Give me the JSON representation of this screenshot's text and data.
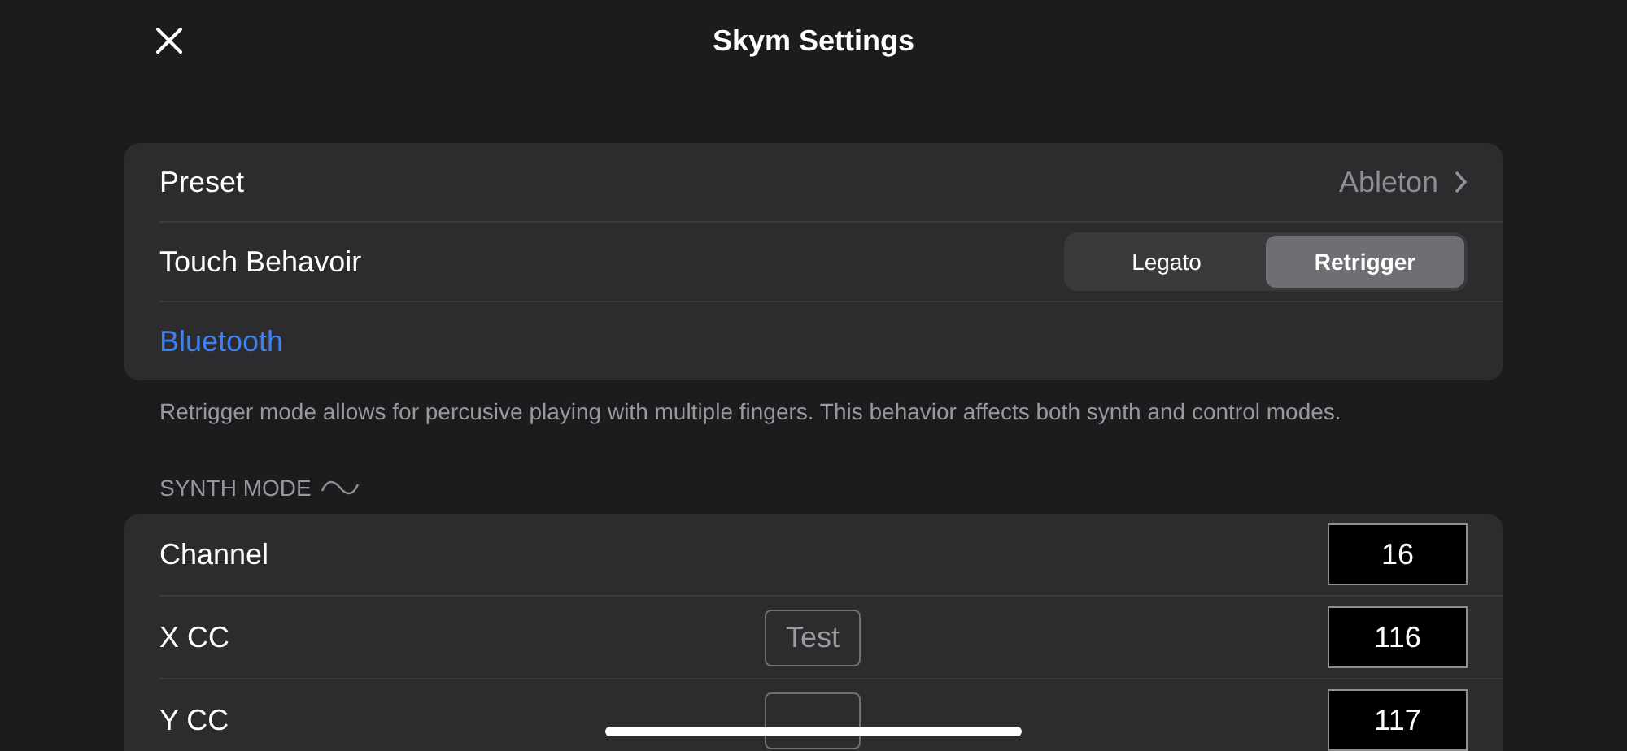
{
  "header": {
    "title": "Skym Settings"
  },
  "general": {
    "rows": [
      {
        "kind": "disclosure",
        "label": "Preset",
        "value": "Ableton"
      },
      {
        "kind": "segmented",
        "label": "Touch Behavoir",
        "options": [
          {
            "label": "Legato",
            "selected": false
          },
          {
            "label": "Retrigger",
            "selected": true
          }
        ]
      },
      {
        "kind": "link",
        "label": "Bluetooth"
      }
    ],
    "footer": "Retrigger mode allows for percusive playing with multiple fingers. This behavior affects both synth and control modes."
  },
  "synth_mode": {
    "heading": "SYNTH MODE",
    "rows": [
      {
        "label": "Channel",
        "has_test_button": false,
        "value": "16"
      },
      {
        "label": "X CC",
        "has_test_button": true,
        "test_button": "Test",
        "value": "116"
      },
      {
        "label": "Y CC",
        "has_test_button": true,
        "value": "117"
      }
    ]
  }
}
